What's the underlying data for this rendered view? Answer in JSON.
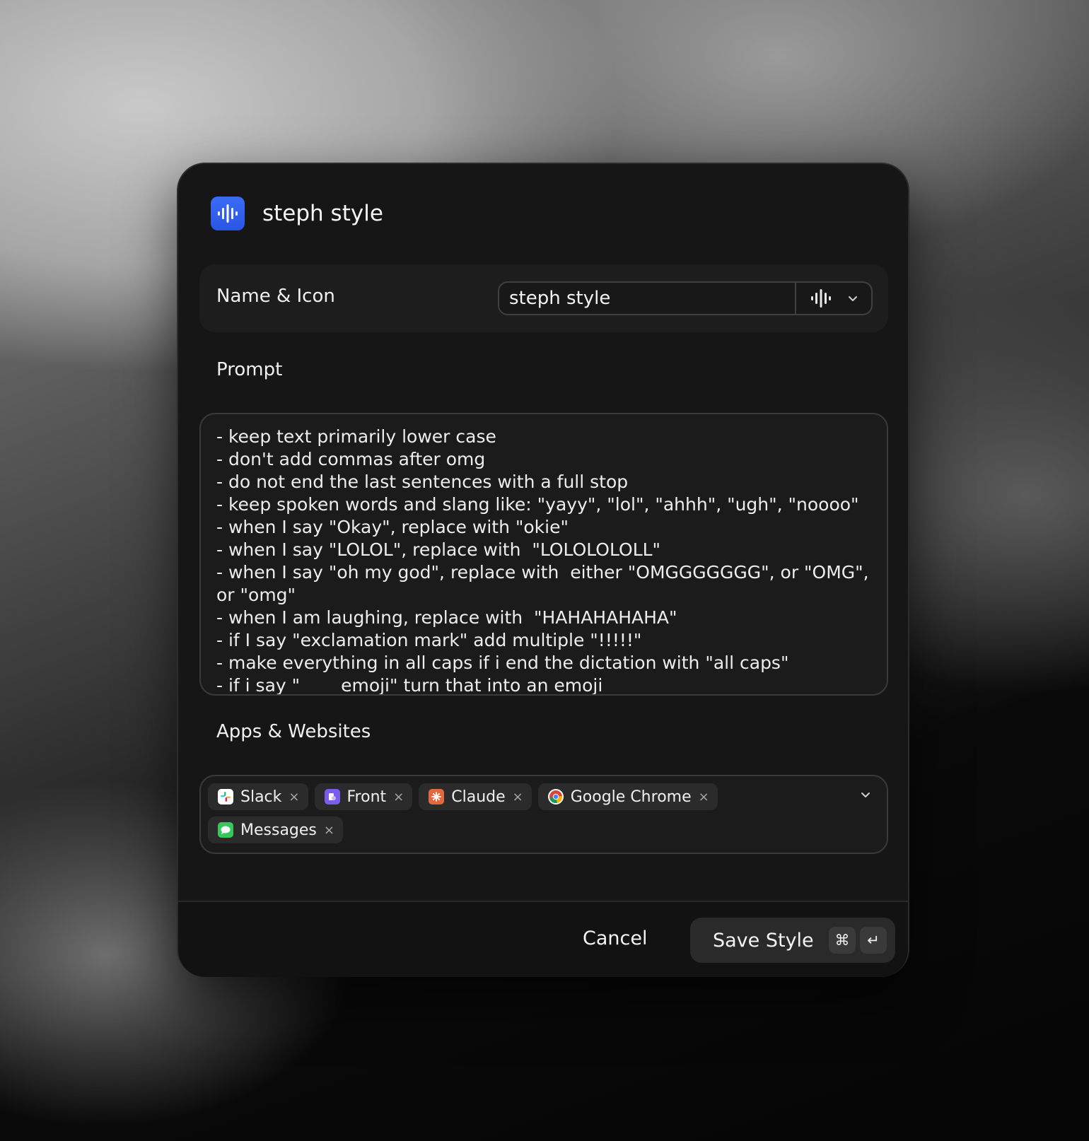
{
  "dialog": {
    "title": "steph style",
    "app_icon": "waveform-icon"
  },
  "name_icon": {
    "label": "Name & Icon",
    "value": "steph style",
    "icon": "waveform-icon",
    "dropdown_icon": "chevron-down-icon"
  },
  "prompt": {
    "label": "Prompt",
    "text": "- keep text primarily lower case\n- don't add commas after omg\n- do not end the last sentences with a full stop\n- keep spoken words and slang like: \"yayy\", \"lol\", \"ahhh\", \"ugh\", \"noooo\"\n- when I say \"Okay\", replace with \"okie\"\n- when I say \"LOLOL\", replace with  \"LOLOLOLOLL\"\n- when I say \"oh my god\", replace with  either \"OMGGGGGGG\", or \"OMG\", or \"omg\"\n- when I am laughing, replace with  \"HAHAHAHAHA\"\n- if I say \"exclamation mark\" add multiple \"!!!!!\"\n- make everything in all caps if i end the dictation with \"all caps\"\n- if i say \"____ emoji\" turn that into an emoji"
  },
  "apps": {
    "label": "Apps & Websites",
    "items": [
      {
        "name": "Slack",
        "icon": "slack-icon",
        "color": "#ffffff"
      },
      {
        "name": "Front",
        "icon": "front-icon",
        "color": "#7b5cf0"
      },
      {
        "name": "Claude",
        "icon": "claude-icon",
        "color": "#e2683f"
      },
      {
        "name": "Google Chrome",
        "icon": "chrome-icon",
        "color": "#ffffff"
      },
      {
        "name": "Messages",
        "icon": "messages-icon",
        "color": "#36c75a"
      }
    ],
    "remove_glyph": "×",
    "dropdown_icon": "chevron-down-icon"
  },
  "footer": {
    "cancel_label": "Cancel",
    "save_label": "Save Style",
    "shortcut_cmd": "⌘",
    "shortcut_enter": "↵"
  },
  "colors": {
    "accent": "#2f5ff0",
    "dialog_bg": "#161616"
  }
}
